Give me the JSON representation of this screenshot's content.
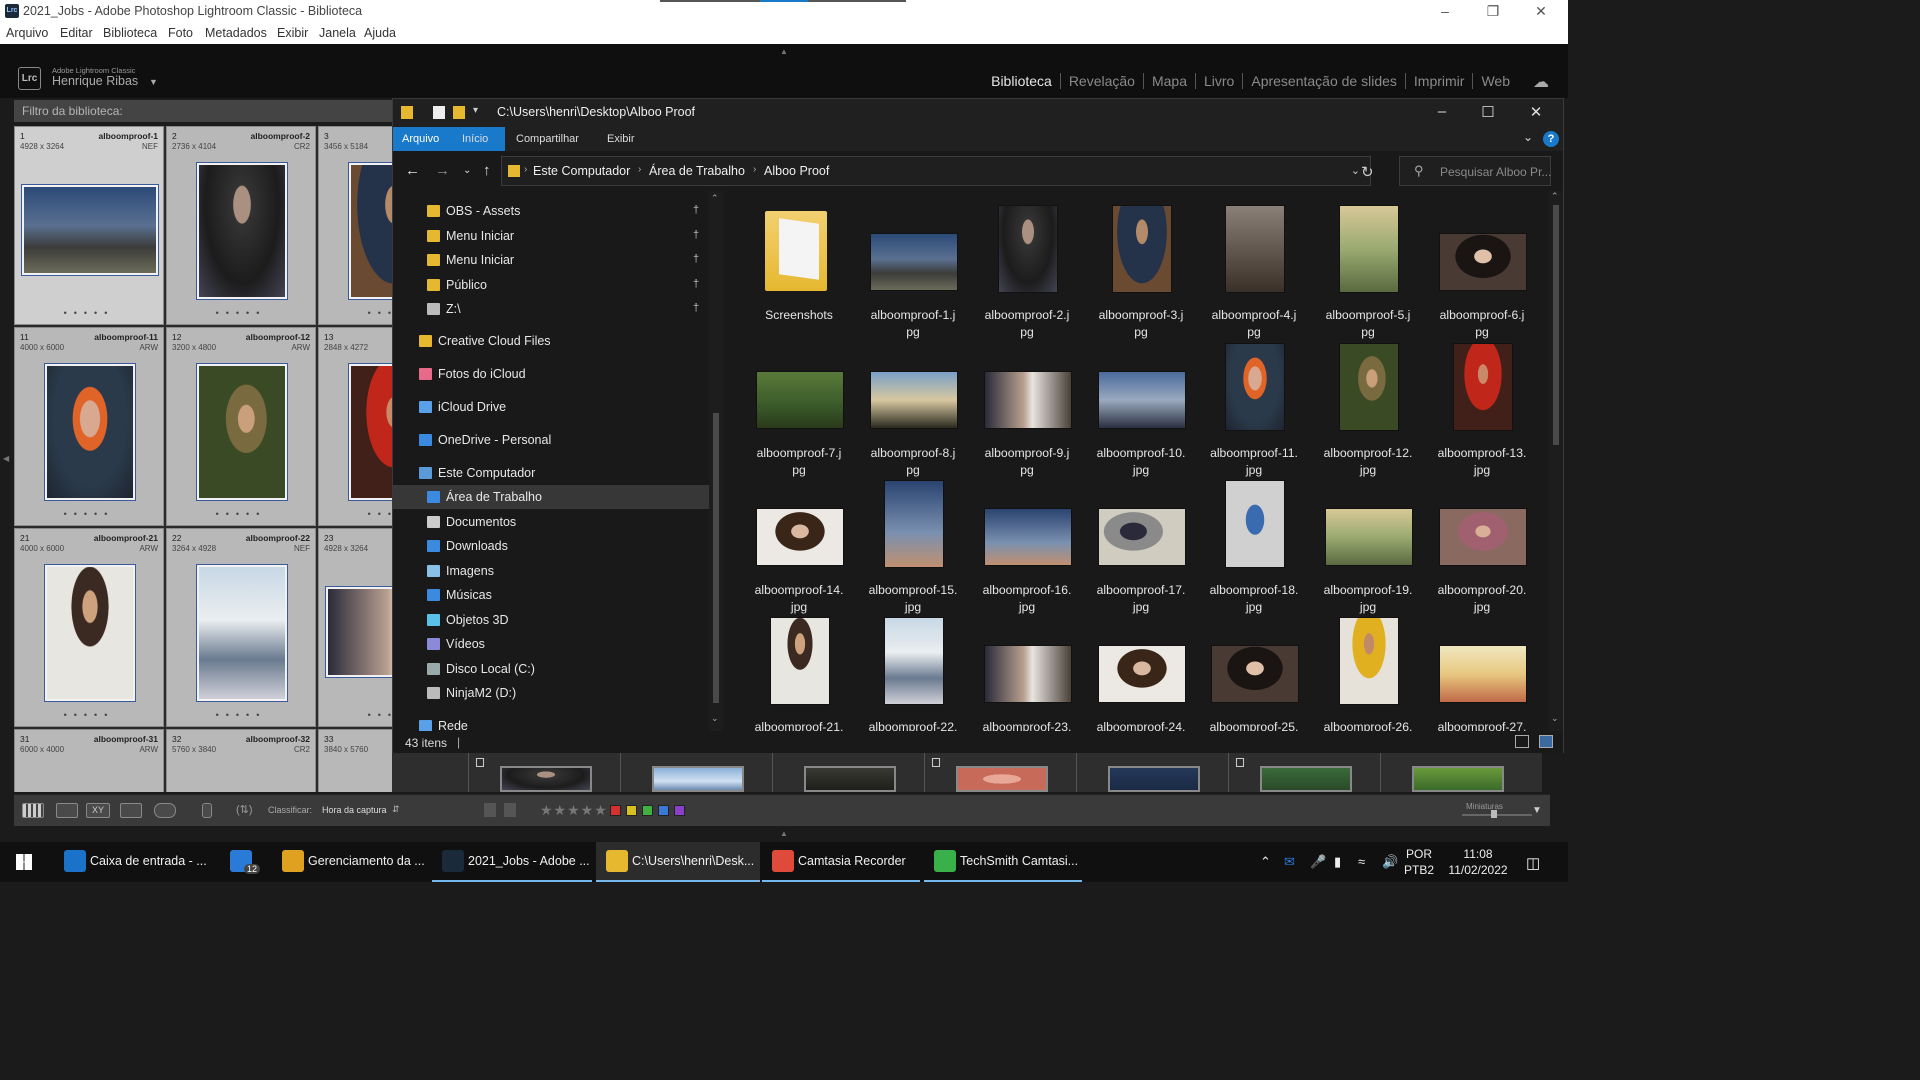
{
  "lightroom": {
    "window_title": "2021_Jobs - Adobe Photoshop Lightroom Classic - Biblioteca",
    "app_badge": "Lrc",
    "menu": [
      "Arquivo",
      "Editar",
      "Biblioteca",
      "Foto",
      "Metadados",
      "Exibir",
      "Janela",
      "Ajuda"
    ],
    "brand_small": "Adobe Lightroom Classic",
    "user": "Henrique Ribas",
    "modules": [
      "Biblioteca",
      "Revelação",
      "Mapa",
      "Livro",
      "Apresentação de slides",
      "Imprimir",
      "Web"
    ],
    "active_module": "Biblioteca",
    "filter_label": "Filtro da biblioteca:",
    "grid_rows": [
      [
        {
          "num": "1",
          "dims": "4928 x 3264",
          "name": "alboomproof-1",
          "ext": "NEF",
          "photo": "ph-bldg"
        },
        {
          "num": "2",
          "dims": "2736 x 4104",
          "name": "alboomproof-2",
          "ext": "CR2",
          "photo": "ph-dark"
        },
        {
          "num": "3",
          "dims": "3456 x 5184",
          "name": "",
          "ext": "",
          "photo": "ph-denim"
        }
      ],
      [
        {
          "num": "11",
          "dims": "4000 x 6000",
          "name": "alboomproof-11",
          "ext": "ARW",
          "photo": "ph-ginger"
        },
        {
          "num": "12",
          "dims": "3200 x 4800",
          "name": "alboomproof-12",
          "ext": "ARW",
          "photo": "ph-forest"
        },
        {
          "num": "13",
          "dims": "2848 x 4272",
          "name": "",
          "ext": "",
          "photo": "ph-red"
        }
      ],
      [
        {
          "num": "21",
          "dims": "4000 x 6000",
          "name": "alboomproof-21",
          "ext": "ARW",
          "photo": "ph-white"
        },
        {
          "num": "22",
          "dims": "3264 x 4928",
          "name": "alboomproof-22",
          "ext": "NEF",
          "photo": "ph-beach"
        },
        {
          "num": "23",
          "dims": "4928 x 3264",
          "name": "",
          "ext": "",
          "photo": "ph-couple"
        }
      ],
      [
        {
          "num": "31",
          "dims": "6000 x 4000",
          "name": "alboomproof-31",
          "ext": "ARW",
          "photo": ""
        },
        {
          "num": "32",
          "dims": "5760 x 3840",
          "name": "alboomproof-32",
          "ext": "CR2",
          "photo": ""
        },
        {
          "num": "33",
          "dims": "3840 x 5760",
          "name": "",
          "ext": "",
          "photo": ""
        }
      ]
    ],
    "toolbar": {
      "sort_label": "Classificar:",
      "sort_value": "Hora da captura",
      "thumbnails_label": "Miniaturas",
      "label_colors": [
        "#d33030",
        "#d8c020",
        "#40b040",
        "#3a78d8",
        "#8a40c8"
      ]
    }
  },
  "explorer": {
    "path": "C:\\Users\\henri\\Desktop\\Alboo Proof",
    "ribbon_tabs": [
      "Arquivo",
      "Início",
      "Compartilhar",
      "Exibir"
    ],
    "breadcrumb": [
      "Este Computador",
      "Área de Trabalho",
      "Alboo Proof"
    ],
    "search_placeholder": "Pesquisar Alboo Pr...",
    "nav": [
      {
        "label": "OBS - Assets",
        "icon": "folder-icon",
        "pinned": true,
        "indent": 1
      },
      {
        "label": "Menu Iniciar",
        "icon": "folder-icon",
        "pinned": true,
        "indent": 1
      },
      {
        "label": "Menu Iniciar",
        "icon": "folder-icon",
        "pinned": true,
        "indent": 1
      },
      {
        "label": "Público",
        "icon": "folder-icon",
        "pinned": true,
        "indent": 1
      },
      {
        "label": "Z:\\",
        "icon": "drive-icon",
        "pinned": true,
        "indent": 1
      },
      {
        "label": "Creative Cloud Files",
        "icon": "creative-cloud-icon",
        "pinned": false,
        "indent": 0
      },
      {
        "label": "Fotos do iCloud",
        "icon": "icloud-photos-icon",
        "pinned": false,
        "indent": 0
      },
      {
        "label": "iCloud Drive",
        "icon": "icloud-drive-icon",
        "pinned": false,
        "indent": 0
      },
      {
        "label": "OneDrive - Personal",
        "icon": "onedrive-icon",
        "pinned": false,
        "indent": 0
      },
      {
        "label": "Este Computador",
        "icon": "computer-icon",
        "pinned": false,
        "indent": 0
      },
      {
        "label": "Área de Trabalho",
        "icon": "desktop-icon",
        "pinned": false,
        "indent": 1,
        "selected": true
      },
      {
        "label": "Documentos",
        "icon": "documents-icon",
        "pinned": false,
        "indent": 1
      },
      {
        "label": "Downloads",
        "icon": "downloads-icon",
        "pinned": false,
        "indent": 1
      },
      {
        "label": "Imagens",
        "icon": "pictures-icon",
        "pinned": false,
        "indent": 1
      },
      {
        "label": "Músicas",
        "icon": "music-icon",
        "pinned": false,
        "indent": 1
      },
      {
        "label": "Objetos 3D",
        "icon": "objects-3d-icon",
        "pinned": false,
        "indent": 1
      },
      {
        "label": "Vídeos",
        "icon": "videos-icon",
        "pinned": false,
        "indent": 1
      },
      {
        "label": "Disco Local (C:)",
        "icon": "local-disk-icon",
        "pinned": false,
        "indent": 1
      },
      {
        "label": "NinjaM2 (D:)",
        "icon": "drive-icon",
        "pinned": false,
        "indent": 1
      },
      {
        "label": "Rede",
        "icon": "network-icon",
        "pinned": false,
        "indent": 0
      }
    ],
    "files": [
      {
        "cap": [
          "Screenshots"
        ],
        "photo": "folder",
        "orient": "folder"
      },
      {
        "cap": [
          "alboomproof-1.j",
          "pg"
        ],
        "photo": "ph-bldg",
        "orient": "land"
      },
      {
        "cap": [
          "alboomproof-2.j",
          "pg"
        ],
        "photo": "ph-dark",
        "orient": "port"
      },
      {
        "cap": [
          "alboomproof-3.j",
          "pg"
        ],
        "photo": "ph-denim",
        "orient": "port"
      },
      {
        "cap": [
          "alboomproof-4.j",
          "pg"
        ],
        "photo": "ph-rock",
        "orient": "port"
      },
      {
        "cap": [
          "alboomproof-5.j",
          "pg"
        ],
        "photo": "ph-outdoor",
        "orient": "port"
      },
      {
        "cap": [
          "alboomproof-6.j",
          "pg"
        ],
        "photo": "ph-darkhair",
        "orient": "land"
      },
      {
        "cap": [
          "alboomproof-7.j",
          "pg"
        ],
        "photo": "ph-grass",
        "orient": "land"
      },
      {
        "cap": [
          "alboomproof-8.j",
          "pg"
        ],
        "photo": "ph-sunset",
        "orient": "land"
      },
      {
        "cap": [
          "alboomproof-9.j",
          "pg"
        ],
        "photo": "ph-couple",
        "orient": "land"
      },
      {
        "cap": [
          "alboomproof-10.",
          "jpg"
        ],
        "photo": "ph-city",
        "orient": "land"
      },
      {
        "cap": [
          "alboomproof-11.",
          "jpg"
        ],
        "photo": "ph-ginger",
        "orient": "port"
      },
      {
        "cap": [
          "alboomproof-12.",
          "jpg"
        ],
        "photo": "ph-forest",
        "orient": "port"
      },
      {
        "cap": [
          "alboomproof-13.",
          "jpg"
        ],
        "photo": "ph-red",
        "orient": "port"
      },
      {
        "cap": [
          "alboomproof-14.",
          "jpg"
        ],
        "photo": "ph-brunette",
        "orient": "land"
      },
      {
        "cap": [
          "alboomproof-15.",
          "jpg"
        ],
        "photo": "ph-sky",
        "orient": "port"
      },
      {
        "cap": [
          "alboomproof-16.",
          "jpg"
        ],
        "photo": "ph-sky",
        "orient": "land"
      },
      {
        "cap": [
          "alboomproof-17.",
          "jpg"
        ],
        "photo": "ph-girlrock",
        "orient": "land"
      },
      {
        "cap": [
          "alboomproof-18.",
          "jpg"
        ],
        "photo": "ph-blueskirt",
        "orient": "port"
      },
      {
        "cap": [
          "alboomproof-19.",
          "jpg"
        ],
        "photo": "ph-outdoor",
        "orient": "land"
      },
      {
        "cap": [
          "alboomproof-20.",
          "jpg"
        ],
        "photo": "ph-pinkcoat",
        "orient": "land"
      },
      {
        "cap": [
          "alboomproof-21."
        ],
        "photo": "ph-white",
        "orient": "port"
      },
      {
        "cap": [
          "alboomproof-22."
        ],
        "photo": "ph-beach",
        "orient": "port"
      },
      {
        "cap": [
          "alboomproof-23."
        ],
        "photo": "ph-couple",
        "orient": "land"
      },
      {
        "cap": [
          "alboomproof-24."
        ],
        "photo": "ph-brunette",
        "orient": "land"
      },
      {
        "cap": [
          "alboomproof-25."
        ],
        "photo": "ph-darkhair",
        "orient": "land"
      },
      {
        "cap": [
          "alboomproof-26."
        ],
        "photo": "ph-yellow",
        "orient": "port"
      },
      {
        "cap": [
          "alboomproof-27."
        ],
        "photo": "ph-party",
        "orient": "land"
      }
    ],
    "status_count": "43 itens"
  },
  "taskbar": {
    "apps": [
      {
        "label": "Caixa de entrada - ...",
        "icon": "outlook-icon",
        "color": "#1a73c8"
      },
      {
        "label": "",
        "icon": "mail-badge-icon",
        "badge": "12",
        "color": "#2a7ad8"
      },
      {
        "label": "Gerenciamento da ...",
        "icon": "chrome-icon",
        "color": "#e0a020"
      },
      {
        "label": "2021_Jobs - Adobe ...",
        "icon": "lightroom-icon",
        "color": "#1b2a3b"
      },
      {
        "label": "C:\\Users\\henri\\Desk...",
        "icon": "file-explorer-icon",
        "color": "#e6b830"
      },
      {
        "label": "Camtasia Recorder",
        "icon": "camtasia-recorder-icon",
        "color": "#e04a3a"
      },
      {
        "label": "TechSmith Camtasi...",
        "icon": "camtasia-icon",
        "color": "#3ab04a"
      }
    ],
    "lang": "POR",
    "lang2": "PTB2",
    "time": "11:08",
    "date": "11/02/2022"
  }
}
